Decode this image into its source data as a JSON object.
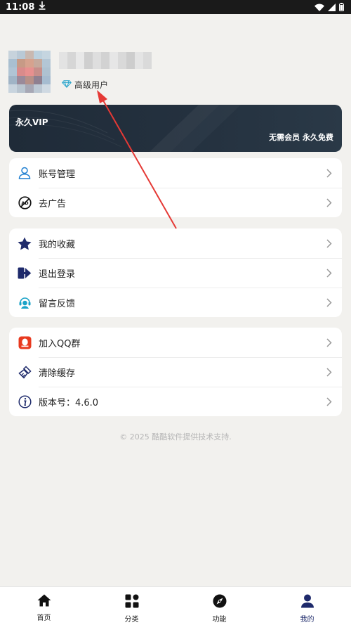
{
  "status_bar": {
    "time": "11:08"
  },
  "profile": {
    "level_label": "高级用户"
  },
  "vip_card": {
    "title": "永久VIP",
    "subtitle": "无需会员 永久免费"
  },
  "group1": [
    {
      "label": "账号管理",
      "icon": "user-icon"
    },
    {
      "label": "去广告",
      "icon": "no-ads-icon"
    }
  ],
  "group2": [
    {
      "label": "我的收藏",
      "icon": "star-icon"
    },
    {
      "label": "退出登录",
      "icon": "logout-icon"
    },
    {
      "label": "留言反馈",
      "icon": "feedback-icon"
    }
  ],
  "group3": [
    {
      "label": "加入QQ群",
      "icon": "qq-icon"
    },
    {
      "label": "清除缓存",
      "icon": "broom-icon"
    },
    {
      "label": "版本号：4.6.0",
      "icon": "info-icon"
    }
  ],
  "footer": {
    "copyright": "© 2025 酷酷软件提供技术支持."
  },
  "bottom_nav": [
    {
      "label": "首页",
      "icon": "home-icon"
    },
    {
      "label": "分类",
      "icon": "grid-icon"
    },
    {
      "label": "功能",
      "icon": "compass-icon"
    },
    {
      "label": "我的",
      "icon": "person-icon",
      "active": true
    }
  ],
  "colors": {
    "accent": "#1e2a6b",
    "vip_bg": "#222f3c",
    "background": "#f2f1ee",
    "arrow": "#e53935"
  }
}
